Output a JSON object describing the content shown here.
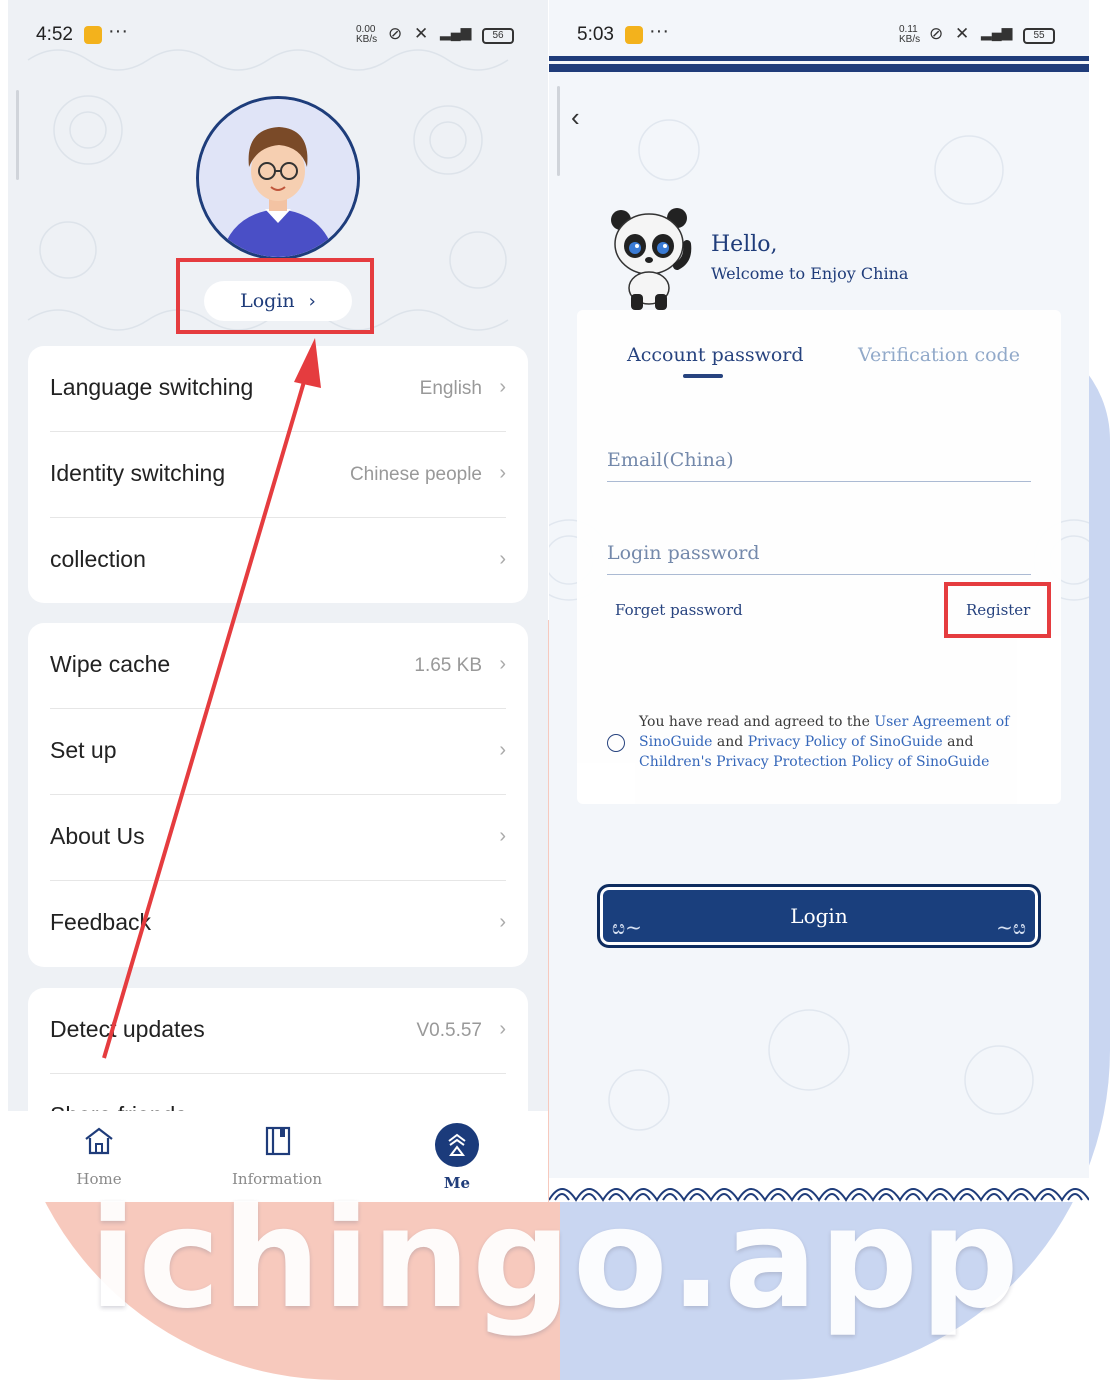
{
  "watermark": "ichingo.app",
  "left_screen": {
    "status_bar": {
      "time": "4:52",
      "net_speed": "0.00 KB/s",
      "battery": "56"
    },
    "login_label": "Login",
    "settings_group_1": [
      {
        "label": "Language switching",
        "value": "English"
      },
      {
        "label": "Identity switching",
        "value": "Chinese people"
      },
      {
        "label": "collection",
        "value": ""
      }
    ],
    "settings_group_2": [
      {
        "label": "Wipe cache",
        "value": "1.65 KB"
      },
      {
        "label": "Set up",
        "value": ""
      },
      {
        "label": "About Us",
        "value": ""
      },
      {
        "label": "Feedback",
        "value": ""
      }
    ],
    "settings_group_3": [
      {
        "label": "Detect updates",
        "value": "V0.5.57"
      },
      {
        "label": "Share friends",
        "value": ""
      }
    ],
    "bottom_nav": [
      {
        "label": "Home",
        "icon": "home-icon",
        "active": false
      },
      {
        "label": "Information",
        "icon": "book-icon",
        "active": false
      },
      {
        "label": "Me",
        "icon": "profile-icon",
        "active": true
      }
    ]
  },
  "right_screen": {
    "status_bar": {
      "time": "5:03",
      "net_speed": "0.11 KB/s",
      "battery": "55"
    },
    "greeting": "Hello,",
    "welcome": "Welcome to Enjoy China",
    "tabs": [
      {
        "label": "Account password",
        "active": true
      },
      {
        "label": "Verification code",
        "active": false
      }
    ],
    "email_placeholder": "Email(China)",
    "password_placeholder": "Login password",
    "forget_password": "Forget password",
    "register": "Register",
    "agreement": {
      "prefix": "You have read and agreed to the ",
      "link1": "User Agreement of SinoGuide",
      "and1": " and ",
      "link2": "Privacy Policy of SinoGuide",
      "and2": " and ",
      "link3": "Children's Privacy Protection Policy of SinoGuide"
    },
    "login_button": "Login"
  },
  "colors": {
    "navy": "#1f3c7a",
    "highlight_red": "#e53c3f",
    "link_blue": "#2e62b8"
  }
}
